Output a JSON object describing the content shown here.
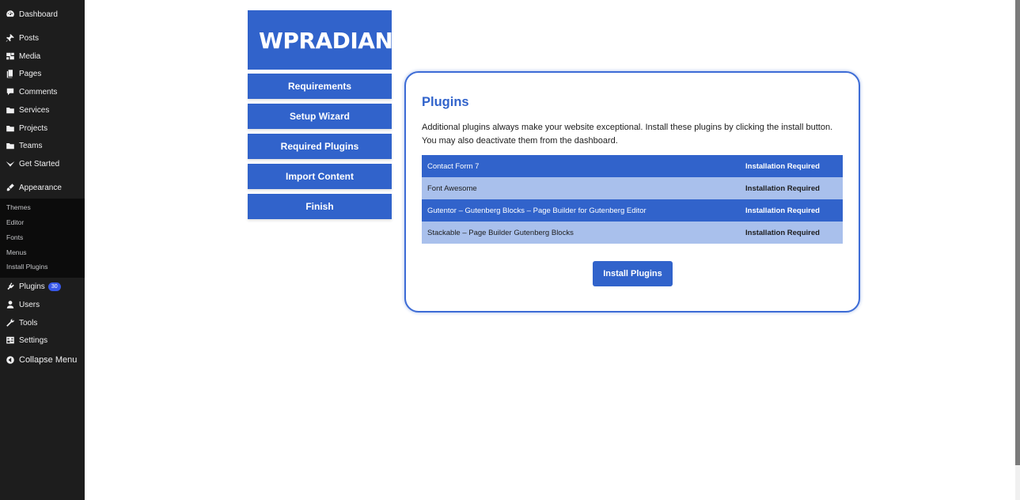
{
  "admin_menu": {
    "items": [
      {
        "label": "Dashboard",
        "icon": "dashboard-icon"
      },
      {
        "label": "Posts",
        "icon": "pin-icon"
      },
      {
        "label": "Media",
        "icon": "media-icon"
      },
      {
        "label": "Pages",
        "icon": "pages-icon"
      },
      {
        "label": "Comments",
        "icon": "comment-icon"
      },
      {
        "label": "Services",
        "icon": "folder-icon"
      },
      {
        "label": "Projects",
        "icon": "folder-icon"
      },
      {
        "label": "Teams",
        "icon": "folder-icon"
      },
      {
        "label": "Get Started",
        "icon": "chevron-down-icon"
      },
      {
        "label": "Appearance",
        "icon": "brush-icon"
      }
    ],
    "appearance_submenu": [
      "Themes",
      "Editor",
      "Fonts",
      "Menus",
      "Install Plugins"
    ],
    "lower_items": [
      {
        "label": "Plugins",
        "icon": "plugin-icon",
        "badge": "30"
      },
      {
        "label": "Users",
        "icon": "user-icon"
      },
      {
        "label": "Tools",
        "icon": "wrench-icon"
      },
      {
        "label": "Settings",
        "icon": "settings-icon"
      }
    ],
    "collapse_label": "Collapse Menu"
  },
  "wizard": {
    "logo_text": "WPRADIANT",
    "steps": [
      "Requirements",
      "Setup Wizard",
      "Required Plugins",
      "Import Content",
      "Finish"
    ]
  },
  "plugins_card": {
    "title": "Plugins",
    "description": "Additional plugins always make your website exceptional. Install these plugins by clicking the install button. You may also deactivate them from the dashboard.",
    "rows": [
      {
        "name": "Contact Form 7",
        "status": "Installation Required"
      },
      {
        "name": "Font Awesome",
        "status": "Installation Required"
      },
      {
        "name": "Gutentor – Gutenberg Blocks – Page Builder for Gutenberg Editor",
        "status": "Installation Required"
      },
      {
        "name": "Stackable – Page Builder Gutenberg Blocks",
        "status": "Installation Required"
      }
    ],
    "install_button": "Install Plugins"
  },
  "colors": {
    "sidebar_bg": "#1d1d1d",
    "brand_blue": "#3163cb",
    "row_light": "#a9c0ec",
    "badge_blue": "#3858e9"
  }
}
